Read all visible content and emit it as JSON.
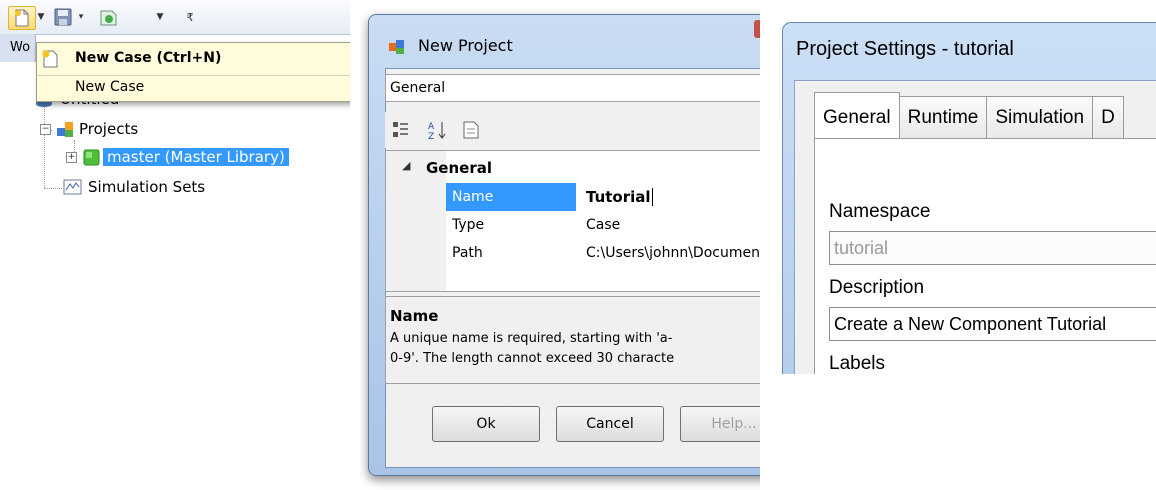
{
  "explorer": {
    "tab_label": "Wo",
    "menu": {
      "item1_label": "New Case (Ctrl+N)",
      "item2_label": "New Case"
    },
    "tree": {
      "root_label": "Untitled",
      "projects_label": "Projects",
      "master_label": "master (Master Library)",
      "simsets_label": "Simulation Sets"
    }
  },
  "new_project": {
    "title": "New Project",
    "category": "General",
    "group_label": "General",
    "rows": [
      {
        "name": "Name",
        "value": "Tutorial"
      },
      {
        "name": "Type",
        "value": "Case"
      },
      {
        "name": "Path",
        "value": "C:\\Users\\johnn\\Documen"
      }
    ],
    "help_title": "Name",
    "help_line1": "A unique name is required, starting with 'a-",
    "help_line2": "0-9'. The length cannot exceed 30 characte",
    "buttons": {
      "ok": "Ok",
      "cancel": "Cancel",
      "help": "Help..."
    }
  },
  "project_settings": {
    "title": "Project Settings - tutorial",
    "tabs": [
      "General",
      "Runtime",
      "Simulation",
      "D"
    ],
    "namespace_label": "Namespace",
    "namespace_value": "tutorial",
    "description_label": "Description",
    "description_value": "Create a New Component Tutorial",
    "labels_label": "Labels"
  },
  "colors": {
    "selection": "#3399ff",
    "menu_bg": "#fffbdb",
    "dialog_frame": "#b9d0ee"
  }
}
